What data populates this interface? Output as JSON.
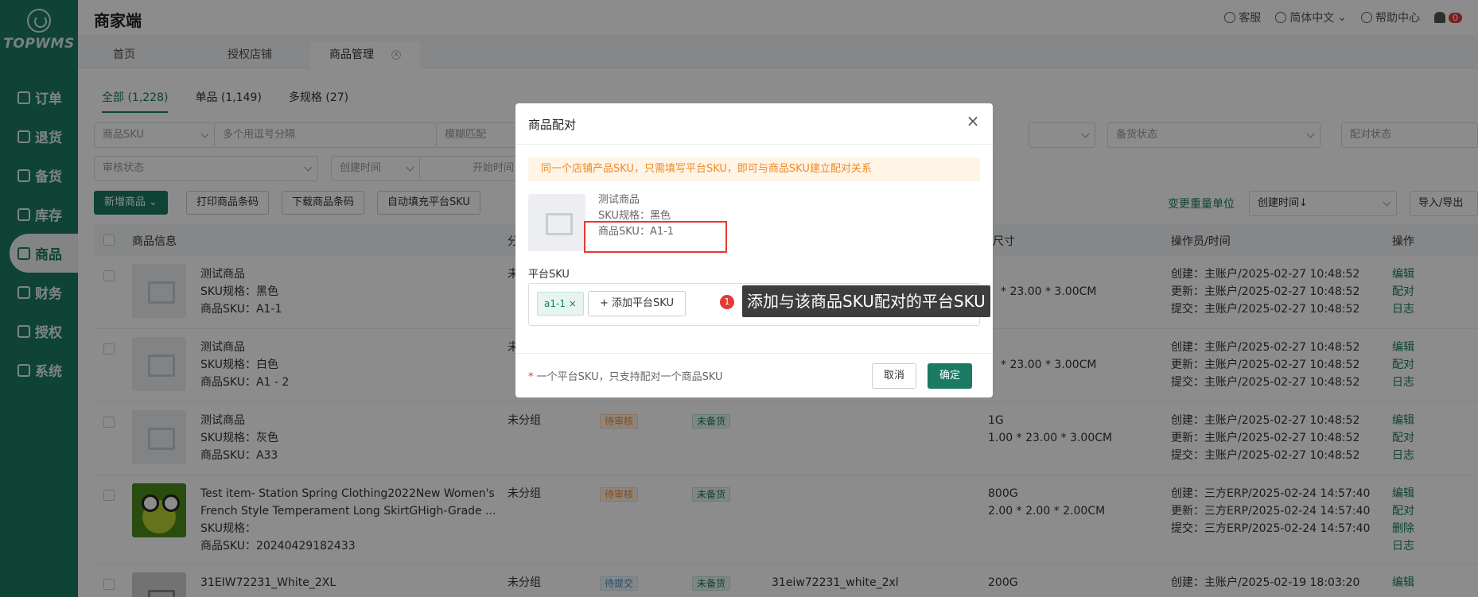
{
  "brand": {
    "logo_text": "TOPWMS"
  },
  "nav": [
    {
      "label": "订单"
    },
    {
      "label": "退货"
    },
    {
      "label": "备货"
    },
    {
      "label": "库存"
    },
    {
      "label": "商品"
    },
    {
      "label": "财务"
    },
    {
      "label": "授权"
    },
    {
      "label": "系统"
    }
  ],
  "header": {
    "title": "商家端",
    "service": "客服",
    "language": "简体中文",
    "help": "帮助中心",
    "notifications": "0"
  },
  "tabs": [
    {
      "label": "首页"
    },
    {
      "label": "授权店铺"
    },
    {
      "label": "商品管理"
    }
  ],
  "subtabs": [
    {
      "label": "全部 (1,228)"
    },
    {
      "label": "单品 (1,149)"
    },
    {
      "label": "多规格 (27)"
    }
  ],
  "filters": {
    "sku_type": "商品SKU",
    "multi_placeholder": "多个用逗号分隔",
    "match": "模糊匹配",
    "stock_status": "备货状态",
    "pair_status": "配对状态",
    "review_status": "审核状态",
    "time_type": "创建时间",
    "start_time": "开始时间"
  },
  "toolbar": {
    "add": "新增商品",
    "print": "打印商品条码",
    "download": "下载商品条码",
    "autofill": "自动填充平台SKU",
    "change_weight": "变更重量单位",
    "sort": "创建时间↓",
    "import_export": "导入/导出"
  },
  "table": {
    "headers": {
      "info": "商品信息",
      "group": "分",
      "size": "尺寸",
      "operator": "操作员/时间",
      "actions": "操作"
    },
    "rows": [
      {
        "name": "测试商品",
        "spec": "SKU规格：黑色",
        "sku": "商品SKU：A1-1",
        "group": "未",
        "size": "* 23.00 * 3.00CM",
        "created": "创建：主账户/2025-02-27 10:48:52",
        "updated": "更新：主账户/2025-02-27 10:48:52",
        "submitted": "提交：主账户/2025-02-27 10:48:52",
        "ops": [
          "编辑",
          "配对",
          "日志"
        ]
      },
      {
        "name": "测试商品",
        "spec": "SKU规格：白色",
        "sku": "商品SKU：A1 - 2",
        "group": "未",
        "size": "* 23.00 * 3.00CM",
        "created": "创建：主账户/2025-02-27 10:48:52",
        "updated": "更新：主账户/2025-02-27 10:48:52",
        "submitted": "提交：主账户/2025-02-27 10:48:52",
        "ops": [
          "编辑",
          "配对",
          "日志"
        ]
      },
      {
        "name": "测试商品",
        "spec": "SKU规格：灰色",
        "sku": "商品SKU：A33",
        "group": "未分组",
        "review": "待审核",
        "stock": "未备货",
        "weight": "1G",
        "size": "1.00 * 23.00 * 3.00CM",
        "created": "创建：主账户/2025-02-27 10:48:52",
        "updated": "更新：主账户/2025-02-27 10:48:52",
        "submitted": "提交：主账户/2025-02-27 10:48:52",
        "ops": [
          "编辑",
          "配对",
          "日志"
        ]
      },
      {
        "name": "Test item- Station Spring Clothing2022New Women's",
        "name2": "French Style Temperament Long SkirtGHigh-Grade ...",
        "spec": "SKU规格：",
        "sku": "商品SKU：20240429182433",
        "group": "未分组",
        "review": "待审核",
        "stock": "未备货",
        "weight": "800G",
        "size": "2.00 * 2.00 * 2.00CM",
        "created": "创建：三方ERP/2025-02-24 14:57:40",
        "updated": "更新：三方ERP/2025-02-24 14:57:40",
        "submitted": "提交：三方ERP/2025-02-24 14:57:40",
        "ops": [
          "编辑",
          "配对",
          "删除",
          "日志"
        ]
      },
      {
        "name": "31EIW72231_White_2XL",
        "group": "未分组",
        "review": "待提交",
        "stock": "未备货",
        "platform_sku": "31eiw72231_white_2xl",
        "weight": "200G",
        "created": "创建：主账户/2025-02-19 18:03:20",
        "ops": [
          "编辑"
        ]
      }
    ]
  },
  "modal": {
    "title": "商品配对",
    "notice": "同一个店铺产品SKU，只需填写平台SKU，即可与商品SKU建立配对关系",
    "product_name": "测试商品",
    "product_spec": "SKU规格：黑色",
    "product_sku": "商品SKU：A1-1",
    "platform_label": "平台SKU",
    "chip": "a1-1",
    "add_button": "+ 添加平台SKU",
    "step": "1",
    "tooltip": "添加与该商品SKU配对的平台SKU",
    "footer_note": "一个平台SKU，只支持配对一个商品SKU",
    "cancel": "取消",
    "confirm": "确定"
  }
}
